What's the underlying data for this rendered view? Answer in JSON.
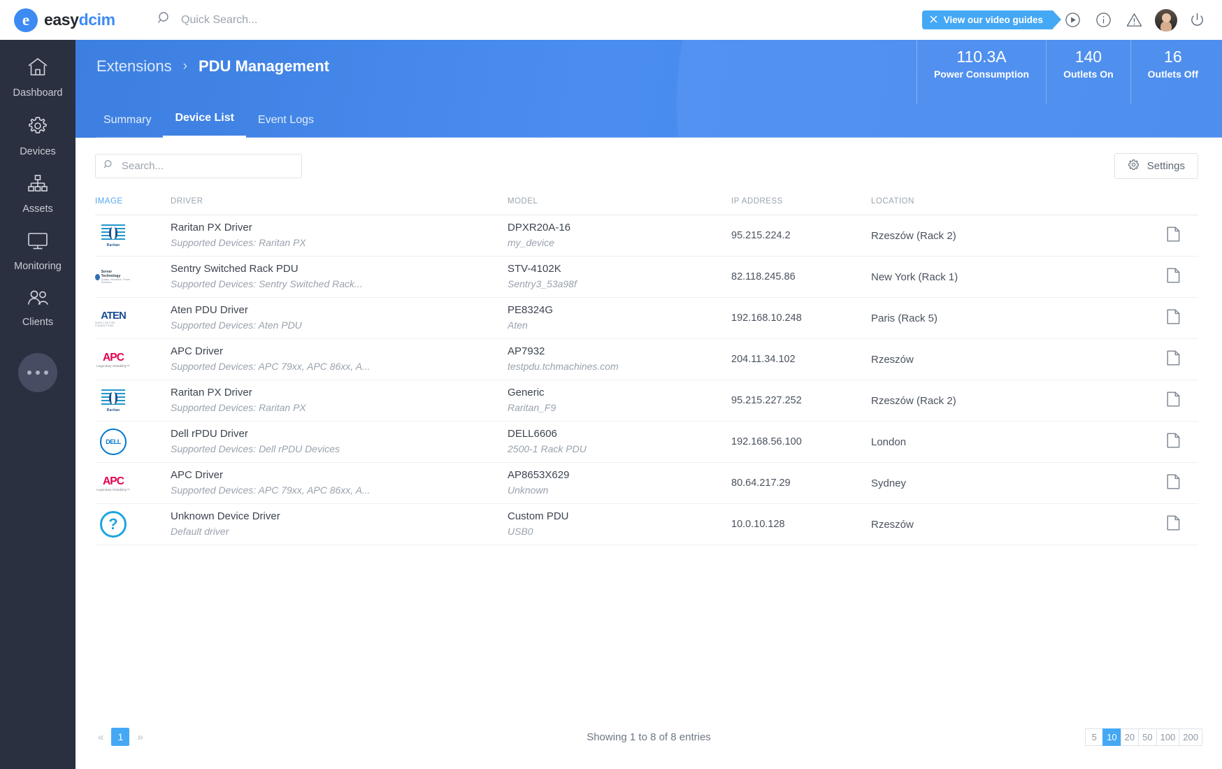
{
  "brand": {
    "name_a": "easy",
    "name_b": "dcim",
    "mark": "e"
  },
  "topbar": {
    "quick_search_placeholder": "Quick Search...",
    "video_guides_label": "View our video guides",
    "icons": [
      "close-icon",
      "play-circle-icon",
      "info-circle-icon",
      "warning-triangle-icon",
      "avatar",
      "power-icon"
    ]
  },
  "sidebar": {
    "items": [
      {
        "label": "Dashboard",
        "icon": "home-icon"
      },
      {
        "label": "Devices",
        "icon": "gear-icon"
      },
      {
        "label": "Assets",
        "icon": "sitemap-icon"
      },
      {
        "label": "Monitoring",
        "icon": "monitor-icon"
      },
      {
        "label": "Clients",
        "icon": "users-icon"
      }
    ],
    "more_label": "more-icon"
  },
  "header": {
    "breadcrumb_parent": "Extensions",
    "breadcrumb_sep": "›",
    "breadcrumb_current": "PDU Management",
    "tabs": [
      {
        "label": "Summary",
        "active": false
      },
      {
        "label": "Device List",
        "active": true
      },
      {
        "label": "Event Logs",
        "active": false
      }
    ],
    "stats": [
      {
        "value": "110.3A",
        "label": "Power Consumption"
      },
      {
        "value": "140",
        "label": "Outlets On"
      },
      {
        "value": "16",
        "label": "Outlets Off"
      }
    ]
  },
  "toolbar": {
    "search_placeholder": "Search...",
    "settings_label": "Settings"
  },
  "table": {
    "columns": [
      "IMAGE",
      "DRIVER",
      "MODEL",
      "IP ADDRESS",
      "LOCATION"
    ],
    "sorted_column": "IMAGE",
    "rows": [
      {
        "logo": "raritan",
        "driver": "Raritan PX Driver",
        "driver_sub": "Supported Devices: Raritan PX",
        "model": "DPXR20A-16",
        "model_sub": "my_device",
        "ip": "95.215.224.2",
        "location": "Rzeszów (Rack 2)",
        "action": "notes-icon"
      },
      {
        "logo": "sentry",
        "driver": "Sentry Switched Rack PDU",
        "driver_sub": "Supported Devices: Sentry Switched Rack...",
        "model": "STV-4102K",
        "model_sub": "Sentry3_53a98f",
        "ip": "82.118.245.86",
        "location": "New York (Rack 1)",
        "action": "notes-icon"
      },
      {
        "logo": "aten",
        "driver": "Aten PDU Driver",
        "driver_sub": "Supported Devices: Aten PDU",
        "model": "PE8324G",
        "model_sub": "Aten",
        "ip": "192.168.10.248",
        "location": "Paris (Rack 5)",
        "action": "notes-icon"
      },
      {
        "logo": "apc",
        "driver": "APC Driver",
        "driver_sub": "Supported Devices: APC 79xx, APC 86xx, A...",
        "model": "AP7932",
        "model_sub": "testpdu.tchmachines.com",
        "ip": "204.11.34.102",
        "location": "Rzeszów",
        "action": "notes-icon"
      },
      {
        "logo": "raritan",
        "driver": "Raritan PX Driver",
        "driver_sub": "Supported Devices: Raritan PX",
        "model": "Generic",
        "model_sub": "Raritan_F9",
        "ip": "95.215.227.252",
        "location": "Rzeszów (Rack 2)",
        "action": "notes-icon"
      },
      {
        "logo": "dell",
        "driver": "Dell rPDU Driver",
        "driver_sub": "Supported Devices: Dell rPDU Devices",
        "model": "DELL6606",
        "model_sub": "2500-1 Rack PDU",
        "ip": "192.168.56.100",
        "location": "London",
        "action": "notes-icon"
      },
      {
        "logo": "apc",
        "driver": "APC Driver",
        "driver_sub": "Supported Devices: APC 79xx, APC 86xx, A...",
        "model": "AP8653X629",
        "model_sub": "Unknown",
        "ip": "80.64.217.29",
        "location": "Sydney",
        "action": "notes-icon"
      },
      {
        "logo": "unknown",
        "driver": "Unknown Device Driver",
        "driver_sub": "Default driver",
        "model": "Custom PDU",
        "model_sub": "USB0",
        "ip": "10.0.10.128",
        "location": "Rzeszów",
        "action": "notes-icon"
      }
    ]
  },
  "footer": {
    "prev": "«",
    "next": "»",
    "current_page": "1",
    "showing": "Showing 1 to 8 of 8 entries",
    "page_sizes": [
      "5",
      "10",
      "20",
      "50",
      "100",
      "200"
    ],
    "active_page_size": "10"
  },
  "colors": {
    "accent_blue": "#45a8f5",
    "header_blue": "#4a8cf0",
    "sidebar_dark": "#2b3040"
  }
}
